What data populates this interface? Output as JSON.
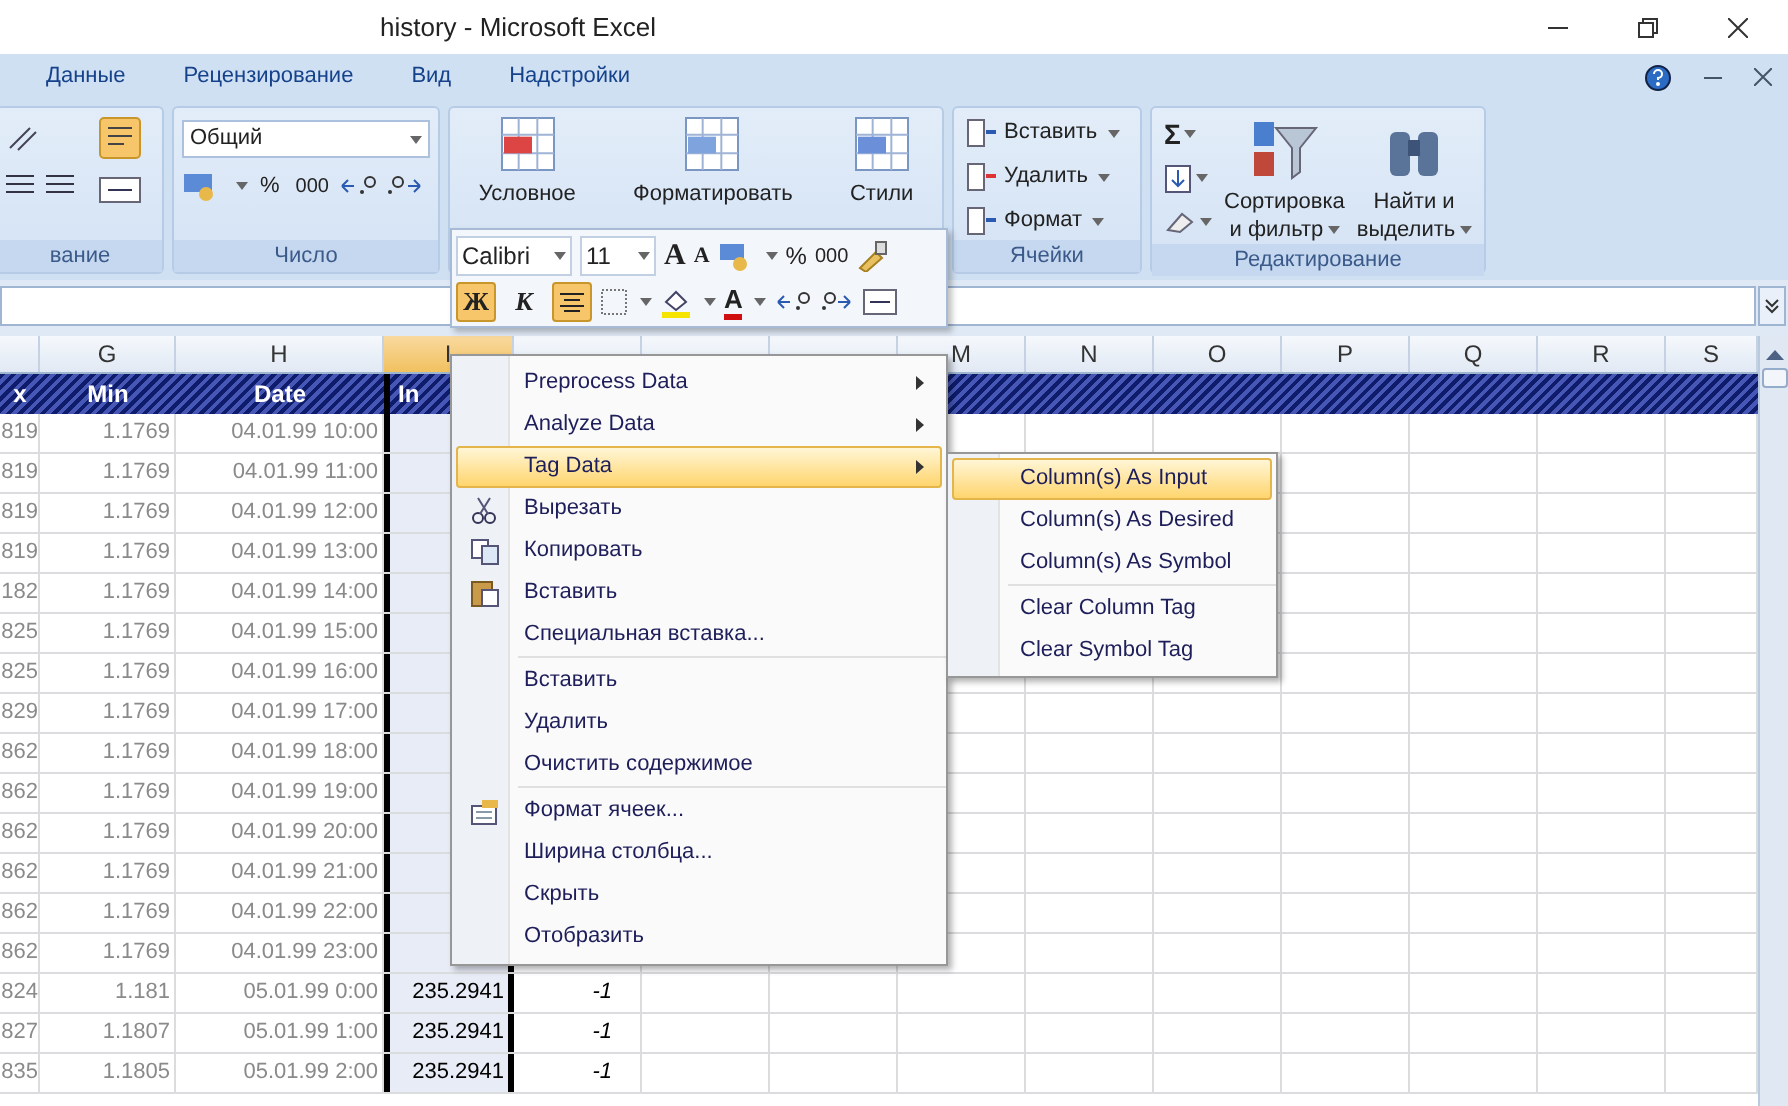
{
  "window": {
    "title": "history - Microsoft Excel"
  },
  "ribbon": {
    "tabs": [
      {
        "label": "Данные"
      },
      {
        "label": "Рецензирование"
      },
      {
        "label": "Вид"
      },
      {
        "label": "Надстройки"
      }
    ],
    "alignment_group": {
      "label": "вание"
    },
    "number_group": {
      "label": "Число",
      "format": "Общий",
      "percent": "%",
      "thousands": "000"
    },
    "styles_group": {
      "buttons": [
        "Условное",
        "Форматировать",
        "Стили"
      ]
    },
    "cells_group": {
      "label": "Ячейки",
      "buttons": [
        "Вставить",
        "Удалить",
        "Формат"
      ]
    },
    "editing_group": {
      "label": "Редактирование",
      "sum": "Σ",
      "buttons": [
        [
          "Сортировка",
          "и фильтр"
        ],
        [
          "Найти и",
          "выделить"
        ]
      ]
    }
  },
  "mini_toolbar": {
    "font": "Calibri",
    "size": "11",
    "grow": "A",
    "shrink": "A",
    "percent": "%",
    "thousands": "000",
    "toggles": [
      {
        "label": "Ж",
        "active": true
      },
      {
        "label": "К",
        "active": false
      }
    ],
    "align_active": true,
    "font_color": "A"
  },
  "sheet": {
    "columns": [
      {
        "selected": false
      },
      {
        "label": "G",
        "selected": false
      },
      {
        "label": "H",
        "selected": false
      },
      {
        "label": "I",
        "selected": true
      },
      {
        "selected": false
      },
      {
        "selected": false
      },
      {
        "selected": false
      },
      {
        "label": "M",
        "selected": false
      },
      {
        "label": "N",
        "selected": false
      },
      {
        "label": "O",
        "selected": false
      },
      {
        "label": "P",
        "selected": false
      },
      {
        "label": "Q",
        "selected": false
      },
      {
        "label": "R",
        "selected": false
      },
      {
        "label": "S",
        "selected": false
      }
    ],
    "header_row": [
      "x",
      "Min",
      "Date",
      "In"
    ],
    "rows": [
      [
        "819",
        "1.1769",
        "04.01.99 10:00"
      ],
      [
        "819",
        "1.1769",
        "04.01.99 11:00"
      ],
      [
        "819",
        "1.1769",
        "04.01.99 12:00"
      ],
      [
        "819",
        "1.1769",
        "04.01.99 13:00"
      ],
      [
        "182",
        "1.1769",
        "04.01.99 14:00"
      ],
      [
        "825",
        "1.1769",
        "04.01.99 15:00"
      ],
      [
        "825",
        "1.1769",
        "04.01.99 16:00"
      ],
      [
        "829",
        "1.1769",
        "04.01.99 17:00"
      ],
      [
        "862",
        "1.1769",
        "04.01.99 18:00"
      ],
      [
        "862",
        "1.1769",
        "04.01.99 19:00"
      ],
      [
        "862",
        "1.1769",
        "04.01.99 20:00"
      ],
      [
        "862",
        "1.1769",
        "04.01.99 21:00"
      ],
      [
        "862",
        "1.1769",
        "04.01.99 22:00"
      ],
      [
        "862",
        "1.1769",
        "04.01.99 23:00"
      ],
      [
        "824",
        "1.181",
        "05.01.99 0:00",
        "235.2941",
        "-1"
      ],
      [
        "827",
        "1.1807",
        "05.01.99 1:00",
        "235.2941",
        "-1"
      ],
      [
        "835",
        "1.1805",
        "05.01.99 2:00",
        "235.2941",
        "-1"
      ]
    ]
  },
  "context_menu": {
    "sections": [
      [
        {
          "label": "Preprocess Data",
          "kind": "submenu",
          "selected": false
        },
        {
          "label": "Analyze Data",
          "kind": "submenu",
          "selected": false
        },
        {
          "label": "Tag Data",
          "kind": "submenu",
          "selected": true
        },
        {
          "label": "Вырезать",
          "kind": "command",
          "selected": false
        },
        {
          "label": "Копировать",
          "kind": "command",
          "selected": false
        },
        {
          "label": "Вставить",
          "kind": "command",
          "selected": false
        },
        {
          "label": "Специальная вставка...",
          "kind": "command",
          "selected": false
        }
      ],
      [
        {
          "label": "Вставить",
          "kind": "command",
          "selected": false
        },
        {
          "label": "Удалить",
          "kind": "command",
          "selected": false
        },
        {
          "label": "Очистить содержимое",
          "kind": "command",
          "selected": false
        }
      ],
      [
        {
          "label": "Формат ячеек...",
          "kind": "command",
          "selected": false
        },
        {
          "label": "Ширина столбца...",
          "kind": "command",
          "selected": false
        },
        {
          "label": "Скрыть",
          "kind": "command",
          "selected": false
        },
        {
          "label": "Отобразить",
          "kind": "command",
          "selected": false
        }
      ]
    ]
  },
  "submenu": {
    "sections": [
      [
        {
          "label": "Column(s) As Input",
          "selected": true
        },
        {
          "label": "Column(s) As Desired",
          "selected": false
        },
        {
          "label": "Column(s) As Symbol",
          "selected": false
        }
      ],
      [
        {
          "label": "Clear Column Tag",
          "selected": false
        },
        {
          "label": "Clear Symbol Tag",
          "selected": false
        }
      ]
    ]
  }
}
